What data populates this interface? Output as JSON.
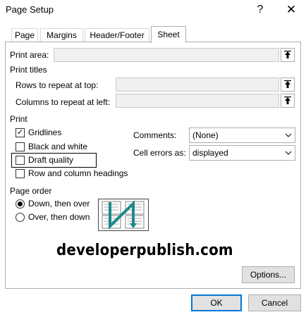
{
  "window": {
    "title": "Page Setup",
    "help_glyph": "?",
    "close_glyph": "✕"
  },
  "tabs": [
    {
      "label": "Page"
    },
    {
      "label": "Margins"
    },
    {
      "label": "Header/Footer"
    },
    {
      "label": "Sheet",
      "active": true
    }
  ],
  "print_area": {
    "label": "Print area:",
    "value": "",
    "button_icon": "collapse-dialog-icon"
  },
  "print_titles": {
    "heading": "Print titles",
    "rows_label": "Rows to repeat at top:",
    "rows_value": "",
    "columns_label": "Columns to repeat at left:",
    "columns_value": ""
  },
  "print": {
    "heading": "Print",
    "gridlines": {
      "label": "Gridlines",
      "checked": true
    },
    "black_and_white": {
      "label": "Black and white",
      "checked": false
    },
    "draft_quality": {
      "label": "Draft quality",
      "checked": false
    },
    "row_col_headings": {
      "label": "Row and column headings",
      "checked": false
    },
    "comments_label": "Comments:",
    "comments_value": "(None)",
    "cell_errors_label": "Cell errors as:",
    "cell_errors_value": "displayed"
  },
  "page_order": {
    "heading": "Page order",
    "down_then_over": {
      "label": "Down, then over",
      "selected": true
    },
    "over_then_down": {
      "label": "Over, then down",
      "selected": false
    }
  },
  "watermark": "developerpublish.com",
  "buttons": {
    "options": "Options...",
    "ok": "OK",
    "cancel": "Cancel"
  },
  "colors": {
    "accent": "#0078d7",
    "button_face": "#e1e1e1",
    "field_disabled": "#f0f0f0",
    "page_order_arrow": "#1a8a8a"
  }
}
